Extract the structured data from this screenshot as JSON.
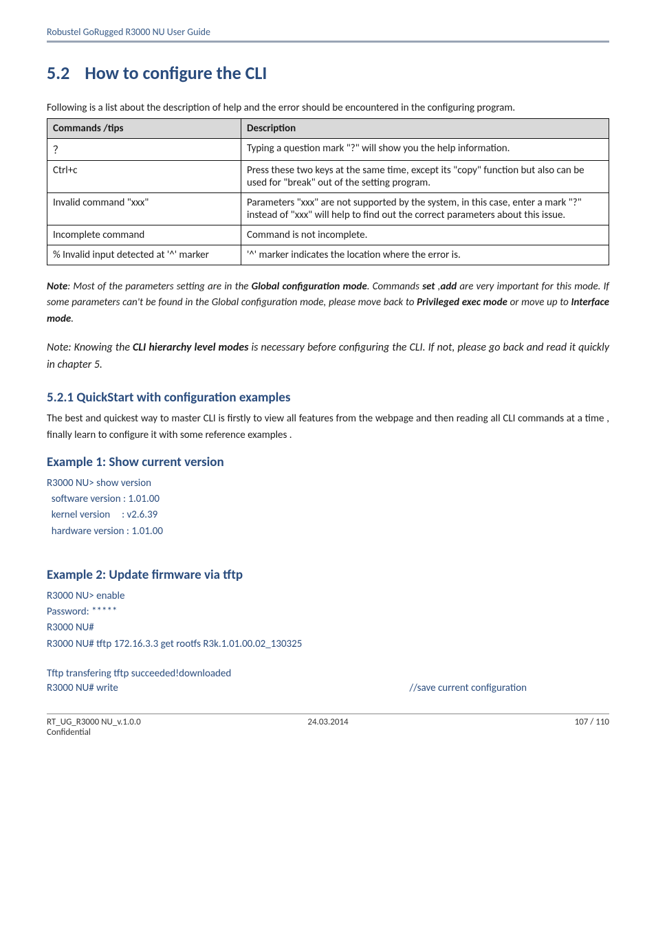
{
  "runningHead": "Robustel GoRugged R3000 NU User Guide",
  "section": {
    "num": "5.2",
    "title": "How to configure the CLI"
  },
  "lead": "Following is a list about the description of help and the error should be encountered in the configuring program.",
  "table": {
    "headers": [
      "Commands /tips",
      "Description"
    ],
    "rows": [
      [
        "？",
        "Typing a question mark \"?\" will show you the help information."
      ],
      [
        "Ctrl+c",
        "Press these two keys at the same time, except its \"copy\" function but also can be used for \"break\" out of the setting program."
      ],
      [
        "Invalid command \"xxx\"",
        "Parameters \"xxx\" are not supported by the system, in this case, enter a mark \"?\" instead of \"xxx\" will help to find out the correct parameters about this issue."
      ],
      [
        "Incomplete command",
        "Command is not incomplete."
      ],
      [
        "% Invalid input detected at '^' marker",
        "'^' marker indicates the location where the error is."
      ]
    ]
  },
  "noteHtml": "<b><i>Note</i></b><i>: Most of the parameters setting are in the </i><b><i>Global configuration mode</i></b><i>. Commands </i><b><i>set</i></b><i> ,</i><b><i>add</i></b><i> are very important for this mode. If some parameters can't be found in the Global configuration mode, please move back to </i><b><i>Privileged exec mode</i></b><i> or move up to </i><b><i>Interface mode</i></b><i>.</i>",
  "note2Html": "<i>Note: Knowing the </i><b><i>CLI hierarchy level modes</i></b><i> is necessary before configuring the CLI. If not, please go back and read it quickly in chapter 5.</i>",
  "sub521": "5.2.1 QuickStart with configuration examples",
  "sub521Para": "The best and quickest way to master CLI is firstly to view all features from the webpage and then reading all CLI commands at a time , finally learn to configure it with some reference examples .",
  "ex1": {
    "title": "Example 1: Show current version",
    "lines": "R3000 NU> show version\n  software version : 1.01.00\n  kernel version     : v2.6.39\n  hardware version : 1.01.00"
  },
  "ex2": {
    "title": "Example 2: Update firmware via tftp",
    "block1": "R3000 NU> enable\nPassword: *****\nR3000 NU#\nR3000 NU# tftp 172.16.3.3 get rootfs R3k.1.01.00.02_130325",
    "block2": "Tftp transfering\ntftp succeeded!downloaded",
    "writeCmd": "R3000 NU# write",
    "writeComment": "//save current configuration"
  },
  "footer": {
    "left": "RT_UG_R3000 NU_v.1.0.0",
    "mid": "24.03.2014",
    "right": "107 / 110",
    "confidential": "Confidential"
  }
}
